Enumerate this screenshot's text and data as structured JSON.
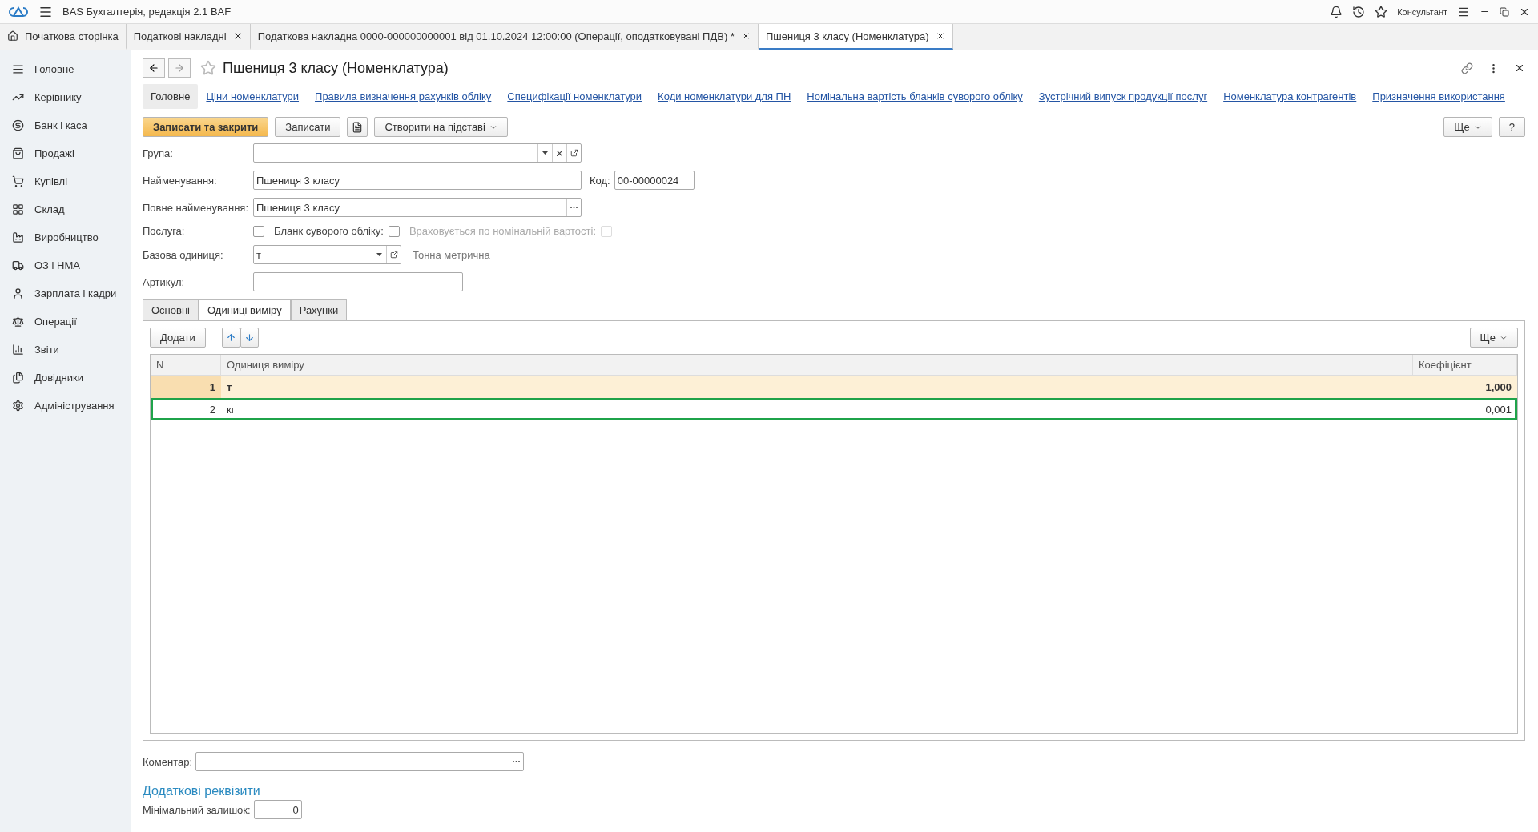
{
  "app": {
    "title": "BAS Бухгалтерія, редакція 2.1 BAF",
    "user": "Консультант"
  },
  "open_tabs": [
    {
      "label": "Початкова сторінка",
      "kind": "home",
      "selected": false
    },
    {
      "label": "Податкові накладні",
      "kind": "doc",
      "selected": false
    },
    {
      "label": "Податкова накладна 0000-000000000001 від 01.10.2024 12:00:00 (Операції, оподатковувані ПДВ) *",
      "kind": "doc",
      "selected": false
    },
    {
      "label": "Пшениця 3 класу (Номенклатура)",
      "kind": "doc",
      "selected": true
    }
  ],
  "sidebar": {
    "items": [
      {
        "label": "Головне",
        "kind": "list"
      },
      {
        "label": "Керівнику",
        "kind": "trend"
      },
      {
        "label": "Банк і каса",
        "kind": "coin"
      },
      {
        "label": "Продажі",
        "kind": "bag"
      },
      {
        "label": "Купівлі",
        "kind": "cart"
      },
      {
        "label": "Склад",
        "kind": "grid"
      },
      {
        "label": "Виробництво",
        "kind": "factory"
      },
      {
        "label": "ОЗ і НМА",
        "kind": "truck"
      },
      {
        "label": "Зарплата і кадри",
        "kind": "person"
      },
      {
        "label": "Операції",
        "kind": "scale"
      },
      {
        "label": "Звіти",
        "kind": "chart"
      },
      {
        "label": "Довідники",
        "kind": "books"
      },
      {
        "label": "Адміністрування",
        "kind": "gear"
      }
    ]
  },
  "form": {
    "title": "Пшениця 3 класу (Номенклатура)",
    "links": [
      {
        "label": "Головне",
        "selected": true
      },
      {
        "label": "Ціни номенклатури",
        "selected": false
      },
      {
        "label": "Правила визначення рахунків обліку",
        "selected": false
      },
      {
        "label": "Специфікації номенклатури",
        "selected": false
      },
      {
        "label": "Коди номенклатури для ПН",
        "selected": false
      },
      {
        "label": "Номінальна вартість бланків суворого обліку",
        "selected": false
      },
      {
        "label": "Зустрічний випуск продукції послуг",
        "selected": false
      },
      {
        "label": "Номенклатура контрагентів",
        "selected": false
      },
      {
        "label": "Призначення використання",
        "selected": false
      }
    ],
    "buttons": {
      "save_close": "Записати та закрити",
      "save": "Записати",
      "create_based": "Створити на підставі",
      "more": "Ще",
      "help": "?"
    },
    "fields": {
      "group": {
        "label": "Група:"
      },
      "name": {
        "label": "Найменування:",
        "value": "Пшениця 3 класу"
      },
      "code": {
        "label": "Код:",
        "value": "00-00000024"
      },
      "full_name": {
        "label": "Повне найменування:",
        "value": "Пшениця 3 класу"
      },
      "checks": [
        {
          "label": "Послуга:",
          "checked": false,
          "disabled": false
        },
        {
          "label": "Бланк суворого обліку:",
          "checked": false,
          "disabled": false
        },
        {
          "label": "Враховується по номінальній вартості:",
          "checked": false,
          "disabled": true
        }
      ],
      "base_unit": {
        "label": "Базова одиниця:",
        "value": "т",
        "description": "Тонна метрична"
      },
      "article": {
        "label": "Артикул:"
      }
    },
    "tabs": [
      {
        "label": "Основні",
        "selected": false
      },
      {
        "label": "Одиниці виміру",
        "selected": true
      },
      {
        "label": "Рахунки",
        "selected": false
      }
    ],
    "table": {
      "add": "Додати",
      "more": "Ще",
      "columns": [
        "N",
        "Одиниця виміру",
        "Коефіцієнт"
      ],
      "rows": [
        {
          "cells": [
            "1",
            "т",
            "1,000"
          ],
          "selected": true,
          "highlighted": false
        },
        {
          "cells": [
            "2",
            "кг",
            "0,001"
          ],
          "selected": false,
          "highlighted": true
        }
      ]
    },
    "comment": {
      "label": "Коментар:"
    },
    "extra": {
      "title": "Додаткові реквізити",
      "min_stock": {
        "label": "Мінімальний залишок:",
        "value": "0"
      }
    }
  }
}
